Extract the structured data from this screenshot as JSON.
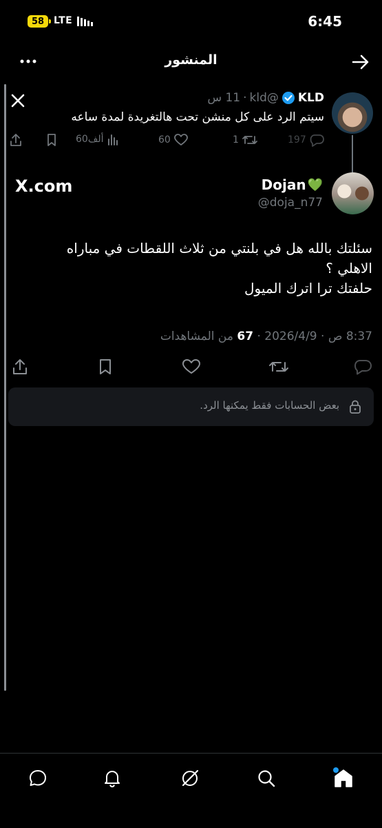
{
  "status_bar": {
    "battery": "58",
    "network": "LTE",
    "time": "6:45"
  },
  "header": {
    "title": "المنشور"
  },
  "parent_tweet": {
    "name": "KLD",
    "handle": "@kld",
    "separator": "·",
    "time_ago": "11 س",
    "text": "سيتم الرد على كل منشن تحت هالتغريدة لمدة ساعه",
    "replies": "197",
    "retweets": "1",
    "likes": "60",
    "views": "60ألف"
  },
  "main_tweet": {
    "source_label": "X.com",
    "name": "Dojan",
    "name_emoji": "💚",
    "handle": "@doja_n77",
    "lines": [
      "سئلتك بالله هل في بلنتي من ثلاث اللقطات في مباراه",
      "الاهلي ؟",
      "حلفتك ترا اترك الميول"
    ],
    "time": "8:37 ص",
    "date": "2026/4/9",
    "separator": "·",
    "views_count": "67",
    "views_label": "من المشاهدات"
  },
  "reply_restriction": {
    "text": "بعض الحسابات فقط يمكنها الرد."
  },
  "colors": {
    "background": "#000000",
    "text": "#e7e9ea",
    "muted": "#71767b",
    "verified": "#1d9bf0",
    "accent": "#1d9bf0",
    "battery": "#f5d90a"
  },
  "icons": [
    "back-arrow-icon",
    "more-icon",
    "x-logo-icon",
    "verified-icon",
    "reply-icon",
    "retweet-icon",
    "like-icon",
    "views-icon",
    "bookmark-icon",
    "share-icon",
    "lock-icon",
    "home-icon",
    "search-icon",
    "grok-icon",
    "notifications-icon",
    "messages-icon"
  ]
}
